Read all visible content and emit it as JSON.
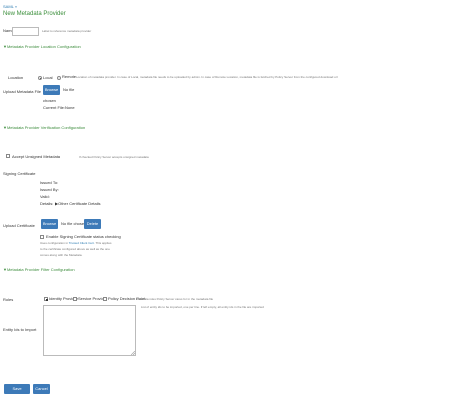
{
  "breadcrumb": "SAML »",
  "page_title": "New Metadata Provider",
  "name": {
    "label": "Name",
    "hint": "Label to reference metadata provider"
  },
  "location_section": {
    "toggle": "▼Metadata Provider Location Configuration"
  },
  "location": {
    "label": "Location",
    "options": [
      "Local",
      "Remote"
    ],
    "hint": "Location of metadata provider. In case of Local, metadata file needs to be uploaded by admin. In case of Remote Location, metadata file is fetched by Policy Server from the configured download url"
  },
  "upload_metadata": {
    "label": "Upload Metadata File",
    "browse": "Browse",
    "no_file": "No file",
    "chosen": "chosen",
    "current_label": "Current File:",
    "current_value": "None"
  },
  "verification_section": {
    "toggle": "▼Metadata Provider Verification Configuration"
  },
  "accept_unsigned": {
    "label": "Accept Unsigned Metadata",
    "hint": "If checked Policy Server accepts unsigned metadata"
  },
  "signing_cert": {
    "label": "Signing Certificate",
    "rows": [
      "Issued To:",
      "Issued By:",
      "Valid:",
      "Details:"
    ],
    "other_details": "▶Other Certificate Details"
  },
  "upload_cert": {
    "label": "Upload Certificate",
    "browse": "Browse",
    "no_file": "No file chosen",
    "delete": "Delete",
    "status_check": "Enable Signing Certificate status checking",
    "help_pre": "Uses configuration in",
    "help_link": "Trusted Client Cert",
    "help_post": ". This applies",
    "help_line2": "to the certificate configured above as well as the one",
    "help_line3": "comes along with the Metadata."
  },
  "filter_section": {
    "toggle": "▼Metadata Provider Filter Configuration"
  },
  "roles": {
    "label": "Roles",
    "options": [
      "Identity Provider",
      "Service Provider",
      "Policy Decision Point"
    ],
    "hint": "Metadata roles Policy Server cares for in the metadata file"
  },
  "entity_ids": {
    "label": "Entity Ids to Import",
    "hint": "List of entity ids to be imported, one per line. If left empty, all entity ids in the file are imported"
  },
  "actions": {
    "save": "Save Changes",
    "cancel": "Cancel"
  },
  "colors": {
    "accent": "#3d7ab8",
    "section_green": "#3c8c3c"
  }
}
